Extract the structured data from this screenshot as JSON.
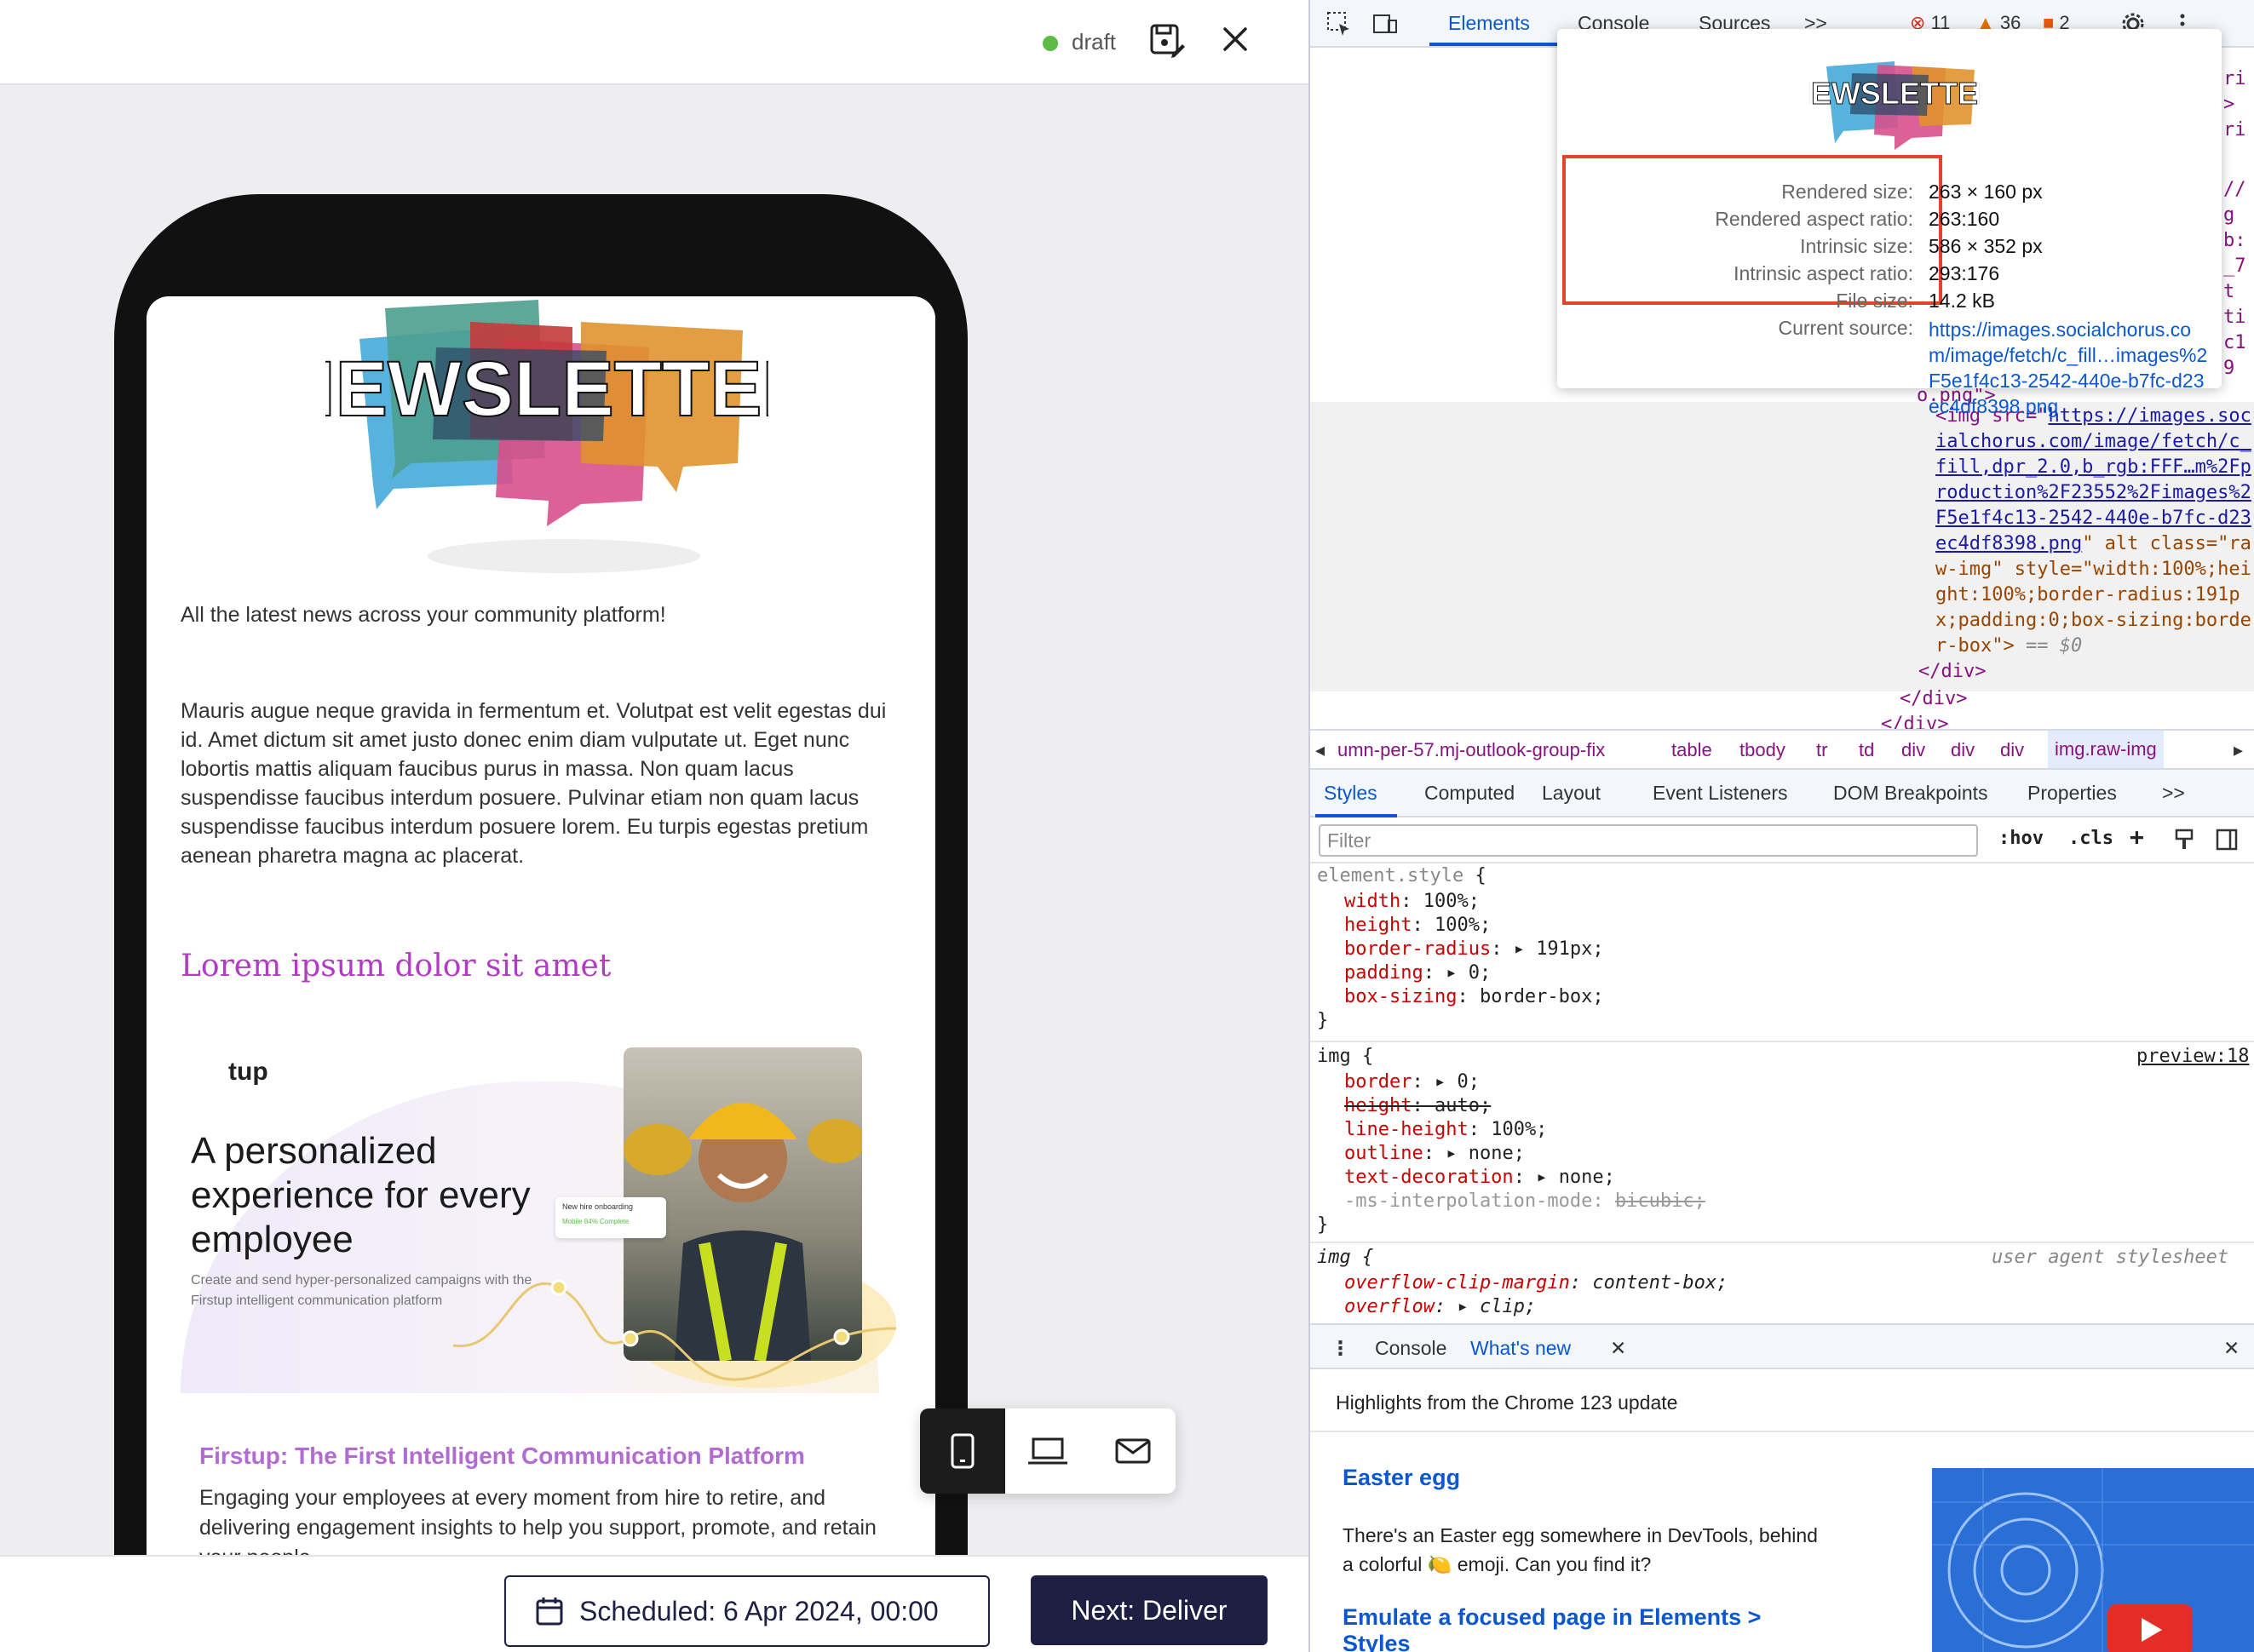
{
  "editor": {
    "status": "draft",
    "schedule_label": "Scheduled: 6 Apr 2024, 00:00",
    "next_label": "Next: Deliver"
  },
  "newsletter": {
    "art_text": "NEWSLETTER",
    "intro": "All the latest news across your community platform!",
    "body": "Mauris augue neque gravida in fermentum et. Volutpat est velit egestas dui id. Amet dictum sit amet justo donec enim diam vulputate ut. Eget nunc lobortis mattis aliquam faucibus purus in massa. Non quam lacus suspendisse faucibus interdum posuere. Pulvinar etiam non quam lacus suspendisse faucibus interdum posuere lorem. Eu turpis egestas pretium aenean pharetra magna ac placerat.",
    "heading": "Lorem ipsum dolor sit amet",
    "promo": {
      "logo_text": "tup",
      "title": "A personalized experience for every employee",
      "subtitle": "Create and send hyper-personalized campaigns with the Firstup intelligent communication platform",
      "mini_card_title": "New hire onboarding",
      "mini_card_meta": "Mobile   84% Complete"
    },
    "card_title": "Firstup: The First Intelligent Communication Platform",
    "card_text": "Engaging your employees at every moment from hire to retire, and delivering engagement insights to help you support, promote, and retain your people."
  },
  "colors": {
    "accent_purple": "#b13cc4",
    "navy": "#1d2042",
    "status_green": "#5dbb46",
    "devtools_blue": "#0b57d0",
    "highlight_red": "#e0452a"
  },
  "devtools": {
    "tabs": [
      "Elements",
      "Console",
      "Sources"
    ],
    "more": ">>",
    "errors": "11",
    "warnings": "36",
    "info": "2",
    "tooltip": {
      "rows": [
        {
          "key": "Rendered size:",
          "value": "263 × 160 px"
        },
        {
          "key": "Rendered aspect ratio:",
          "value": "263:160"
        },
        {
          "key": "Intrinsic size:",
          "value": "586 × 352 px"
        },
        {
          "key": "Intrinsic aspect ratio:",
          "value": "293:176"
        },
        {
          "key": "File size:",
          "value": "14.2 kB"
        },
        {
          "key": "Current source:",
          "value": ""
        }
      ],
      "source": "https://images.socialchorus.com/image/fetch/c_fill…images%2F5e1f4c13-2542-440e-b7fc-d23ec4df8398.png"
    },
    "dom_lines": {
      "img_open": "<img src=\"",
      "img_src_1": "https://images.soc",
      "img_src_2": "ialchorus.com/image/fetch/c_",
      "img_src_3": "fill,dpr_2.0,b_rgb:FFF…m%2Fp",
      "img_src_4": "roduction%2F23552%2Fimages%2",
      "img_src_5": "F5e1f4c13-2542-440e-b7fc-d23",
      "img_src_6": "ec4df8398.png",
      "img_after": "\" alt class=\"ra",
      "img_l7": "w-img\" style=\"width:100%;hei",
      "img_l8": "ght:100%;border-radius:191p",
      "img_l9": "x;padding:0;box-sizing:borde",
      "img_l10": "r-box\">",
      "img_eq": "== $0",
      "close_div_1": "</div>",
      "close_div_2": "</div>",
      "close_div_3": "</div>",
      "png_frag": "o.png\">",
      "right_frags": [
        "ri",
        ">",
        "ri",
        "//",
        "g",
        "b:",
        "_7",
        "t",
        "ti",
        "c1",
        "9"
      ]
    },
    "breadcrumb": [
      "umn-per-57.mj-outlook-group-fix",
      "table",
      "tbody",
      "tr",
      "td",
      "div",
      "div",
      "div",
      "img.raw-img"
    ],
    "style_tabs": [
      "Styles",
      "Computed",
      "Layout",
      "Event Listeners",
      "DOM Breakpoints",
      "Properties"
    ],
    "filter_placeholder": "Filter",
    "hov": ":hov",
    "cls": ".cls",
    "rules": {
      "element_style": "element.style",
      "es_props": [
        {
          "p": "width",
          "v": "100%;"
        },
        {
          "p": "height",
          "v": "100%;"
        },
        {
          "p": "border-radius",
          "v": "191px;"
        },
        {
          "p": "padding",
          "v": "0;"
        },
        {
          "p": "box-sizing",
          "v": "border-box;"
        }
      ],
      "img_sel": "img",
      "img_source": "preview:18",
      "img_props": [
        {
          "p": "border",
          "v": "0;"
        },
        {
          "p": "height",
          "v": "auto;"
        },
        {
          "p": "line-height",
          "v": "100%;"
        },
        {
          "p": "outline",
          "v": "none;"
        },
        {
          "p": "text-decoration",
          "v": "none;"
        },
        {
          "p": "-ms-interpolation-mode",
          "v": "bicubic;"
        }
      ],
      "ua_sel": "img",
      "ua_source": "user agent stylesheet",
      "ua_props": [
        {
          "p": "overflow-clip-margin",
          "v": "content-box;"
        },
        {
          "p": "overflow",
          "v": "clip;"
        }
      ]
    },
    "drawer": {
      "tabs": [
        "Console",
        "What's new"
      ],
      "highlight": "Highlights from the Chrome 123 update",
      "h1": "Easter egg",
      "p1": "There's an Easter egg somewhere in DevTools, behind a colorful 🍋 emoji. Can you find it?",
      "h2": "Emulate a focused page in Elements > Styles"
    }
  }
}
